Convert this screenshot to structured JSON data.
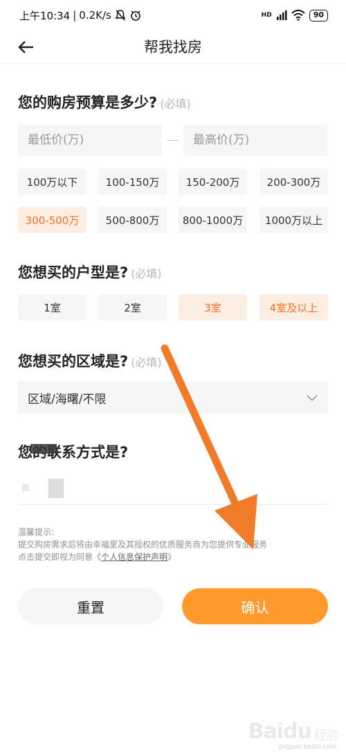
{
  "status_bar": {
    "time": "上午10:34",
    "speed": "0.2K/s",
    "network": "HD",
    "battery": "90"
  },
  "nav": {
    "title": "帮我找房"
  },
  "budget": {
    "title": "您的购房预算是多少?",
    "required": "(必填)",
    "min_placeholder": "最低价(万)",
    "max_placeholder": "最高价(万)",
    "options": [
      {
        "label": "100万以下",
        "selected": false
      },
      {
        "label": "100-150万",
        "selected": false
      },
      {
        "label": "150-200万",
        "selected": false
      },
      {
        "label": "200-300万",
        "selected": false
      },
      {
        "label": "300-500万",
        "selected": true
      },
      {
        "label": "500-800万",
        "selected": false
      },
      {
        "label": "800-1000万",
        "selected": false
      },
      {
        "label": "1000万以上",
        "selected": false
      }
    ]
  },
  "room_type": {
    "title": "您想买的户型是?",
    "required": "(必填)",
    "options": [
      {
        "label": "1室",
        "selected": false
      },
      {
        "label": "2室",
        "selected": false
      },
      {
        "label": "3室",
        "selected": true
      },
      {
        "label": "4室及以上",
        "selected": true
      }
    ]
  },
  "region": {
    "title": "您想买的区域是?",
    "required": "(必填)",
    "value": "区域/海曙/不限"
  },
  "contact": {
    "title": "您的联系方式是?"
  },
  "tips": {
    "heading": "温馨提示:",
    "line1": "提交购房需求后将由幸福里及其授权的优质服务商为您提供专业服务",
    "line2_prefix": "点击提交即视为同意《",
    "privacy_link": "个人信息保护声明",
    "line2_suffix": "》"
  },
  "actions": {
    "reset": "重置",
    "confirm": "确认"
  },
  "watermark": {
    "logo": "Baidu",
    "text": "经验",
    "url": "jingyan.baidu.com"
  },
  "colors": {
    "accent": "#ff9a2e",
    "selected_text": "#f36f22",
    "selected_bg": "#fdeee4",
    "chip_bg": "#f6f6f6",
    "annotation_arrow": "#f07b2a"
  }
}
